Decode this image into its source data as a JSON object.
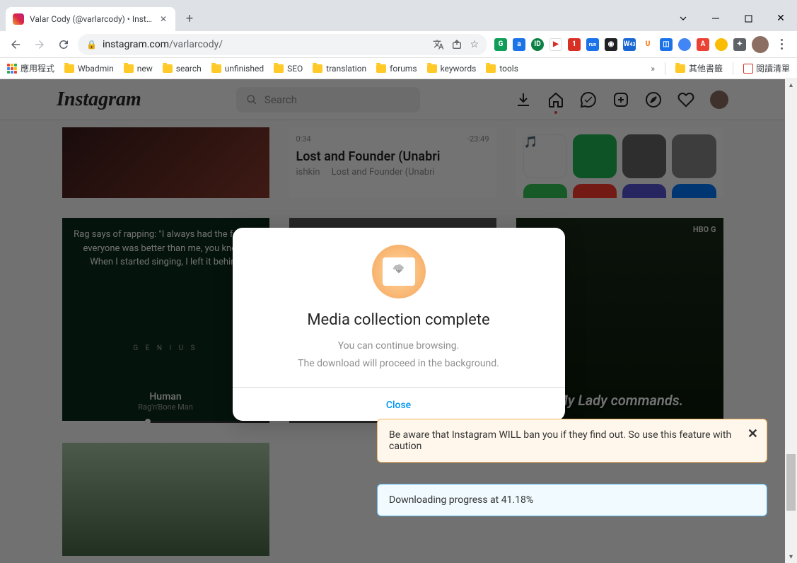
{
  "window": {
    "tab_title": "Valar Cody (@varlarcody) • Instag"
  },
  "toolbar": {
    "url_host": "instagram.com",
    "url_path": "/varlarcody/"
  },
  "bookmarks": {
    "apps": "應用程式",
    "items": [
      "Wbadmin",
      "new",
      "search",
      "unfinished",
      "SEO",
      "translation",
      "forums",
      "keywords",
      "tools"
    ],
    "other": "其他書籤",
    "reading": "閱讀清單"
  },
  "ig": {
    "logo": "Instagram",
    "search_placeholder": "Search"
  },
  "posts": {
    "p2": {
      "time_left": "0:34",
      "time_right": "-23:49",
      "title": "Lost and Founder (Unabri",
      "sub_author": "ishkin",
      "sub_title": "Lost and Founder (Unabri"
    },
    "p4": {
      "quote": "Rag says of rapping: \"I always had the feeling everyone was better than me, you know? When I started singing, I left it behind",
      "genius": "G E N I U S",
      "song": "Human",
      "artist": "Rag'n'Bone Man"
    },
    "p6": {
      "hbo": "HBO G",
      "caption": "My Lady commands."
    }
  },
  "modal": {
    "title": "Media collection complete",
    "line1": "You can continue browsing.",
    "line2": "The download will proceed in the background.",
    "close": "Close"
  },
  "toasts": {
    "warn": "Be aware that Instagram WILL ban you if they find out. So use this feature with caution",
    "info": "Downloading progress at 41.18%"
  }
}
